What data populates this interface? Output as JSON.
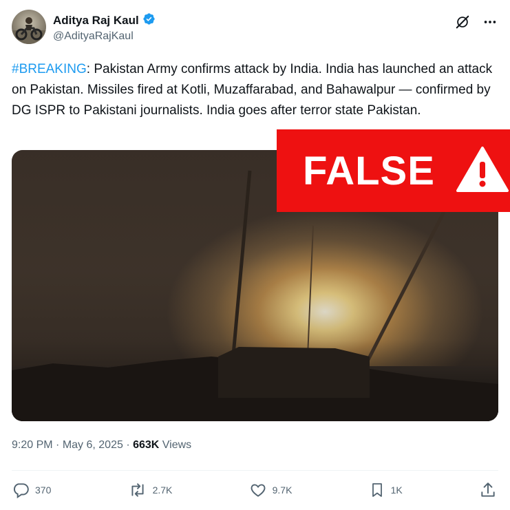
{
  "author": {
    "name": "Aditya Raj Kaul",
    "handle": "@AdityaRajKaul",
    "verified": true
  },
  "top_icons": [
    "grok-icon",
    "more-options-icon"
  ],
  "tweet": {
    "hashtag": "#BREAKING",
    "body": ": Pakistan Army confirms attack by India. India has launched an attack on Pakistan. Missiles fired at Kotli, Muzaffarabad, and Bahawalpur — confirmed by DG ISPR to Pakistani journalists. India goes after terror state Pakistan."
  },
  "fact_check": {
    "label": "FALSE",
    "color": "#ee1111"
  },
  "meta": {
    "time": "9:20 PM",
    "sep1": " · ",
    "date": "May 6, 2025",
    "sep2": " · ",
    "views_count": "663K",
    "views_label": " Views"
  },
  "actions": {
    "replies": "370",
    "reposts": "2.7K",
    "likes": "9.7K",
    "bookmarks": "1K"
  },
  "colors": {
    "accent": "#1d9bf0",
    "text": "#0f1419",
    "secondary": "#536471"
  }
}
